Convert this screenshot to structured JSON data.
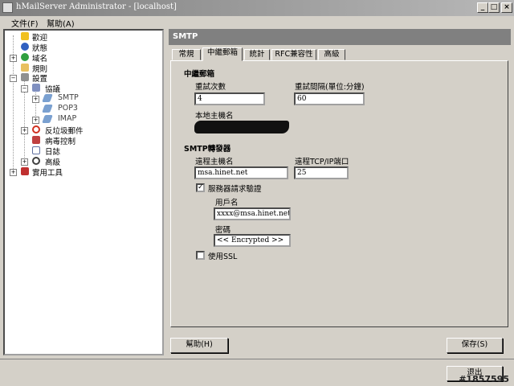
{
  "window": {
    "title": "hMailServer Administrator - [localhost]"
  },
  "menu": {
    "file": "文件(F)",
    "help": "幫助(A)"
  },
  "tree": {
    "welcome": "歡迎",
    "status": "狀態",
    "domains": "域名",
    "rules": "規則",
    "settings": "設置",
    "protocols": "協議",
    "smtp": "SMTP",
    "pop3": "POP3",
    "imap": "IMAP",
    "antispam": "反垃圾郵件",
    "antivirus": "病毒控制",
    "logging": "日誌",
    "advanced": "高級",
    "utilities": "實用工具"
  },
  "main": {
    "header": "SMTP",
    "tabs": [
      "常規",
      "中繼郵箱",
      "統計",
      "RFC兼容性",
      "高級"
    ],
    "active_tab": 1,
    "relay_section": "中繼郵箱",
    "retry_count_label": "重試次數",
    "retry_count_value": "4",
    "retry_interval_label": "重試間隔(單位:分鐘)",
    "retry_interval_value": "60",
    "local_host_label": "本地主機名",
    "smtp_relayer_section": "SMTP轉發器",
    "remote_host_label": "遠程主機名",
    "remote_host_value": "msa.hinet.net",
    "remote_port_label": "遠程TCP/IP端口",
    "remote_port_value": "25",
    "auth_required_label": "服務器請求驗證",
    "auth_required_checked": true,
    "username_label": "用戶名",
    "username_value": "xxxx@msa.hinet.net",
    "password_label": "密碼",
    "password_value": "<< Encrypted >>",
    "use_ssl_label": "使用SSL",
    "use_ssl_checked": false
  },
  "buttons": {
    "help": "幫助(H)",
    "save": "保存(S)",
    "exit": "退出"
  },
  "watermark": "#1857595"
}
